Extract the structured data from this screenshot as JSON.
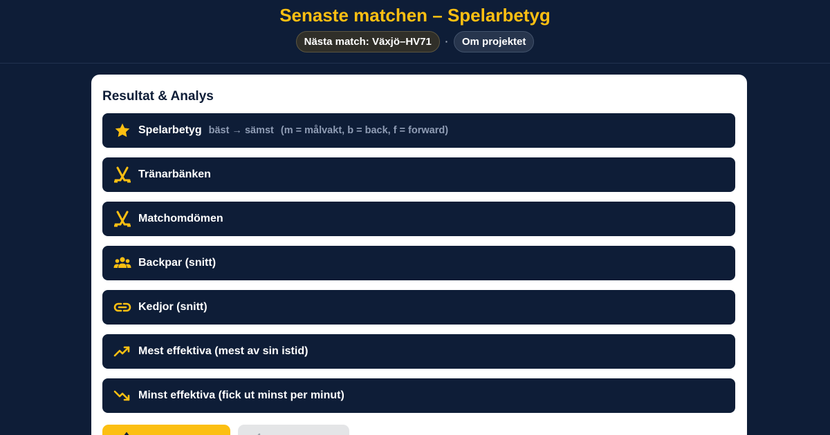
{
  "header": {
    "title": "Senaste matchen – Spelarbetyg",
    "next_match_label": "Nästa match: Växjö–HV71",
    "separator": "·",
    "about_label": "Om projektet"
  },
  "card": {
    "title": "Resultat & Analys",
    "rows": [
      {
        "label": "Spelarbetyg",
        "sub": "bäst → sämst",
        "sub2": "(m = målvakt, b = back, f = forward)",
        "icon": "star-icon"
      },
      {
        "label": "Tränarbänken",
        "icon": "hockey-sticks-icon"
      },
      {
        "label": "Matchomdömen",
        "icon": "hockey-sticks-icon"
      },
      {
        "label": "Backpar (snitt)",
        "icon": "group-icon"
      },
      {
        "label": "Kedjor (snitt)",
        "icon": "link-icon"
      },
      {
        "label": "Mest effektiva (mest av sin istid)",
        "icon": "trending-up-icon"
      },
      {
        "label": "Minst effektiva (fick ut minst per minut)",
        "icon": "trending-down-icon"
      }
    ]
  },
  "colors": {
    "background": "#0e1d37",
    "accent": "#fcbf12",
    "card": "#ffffff",
    "row": "#0e1d37",
    "muted": "#8f9cb4"
  }
}
